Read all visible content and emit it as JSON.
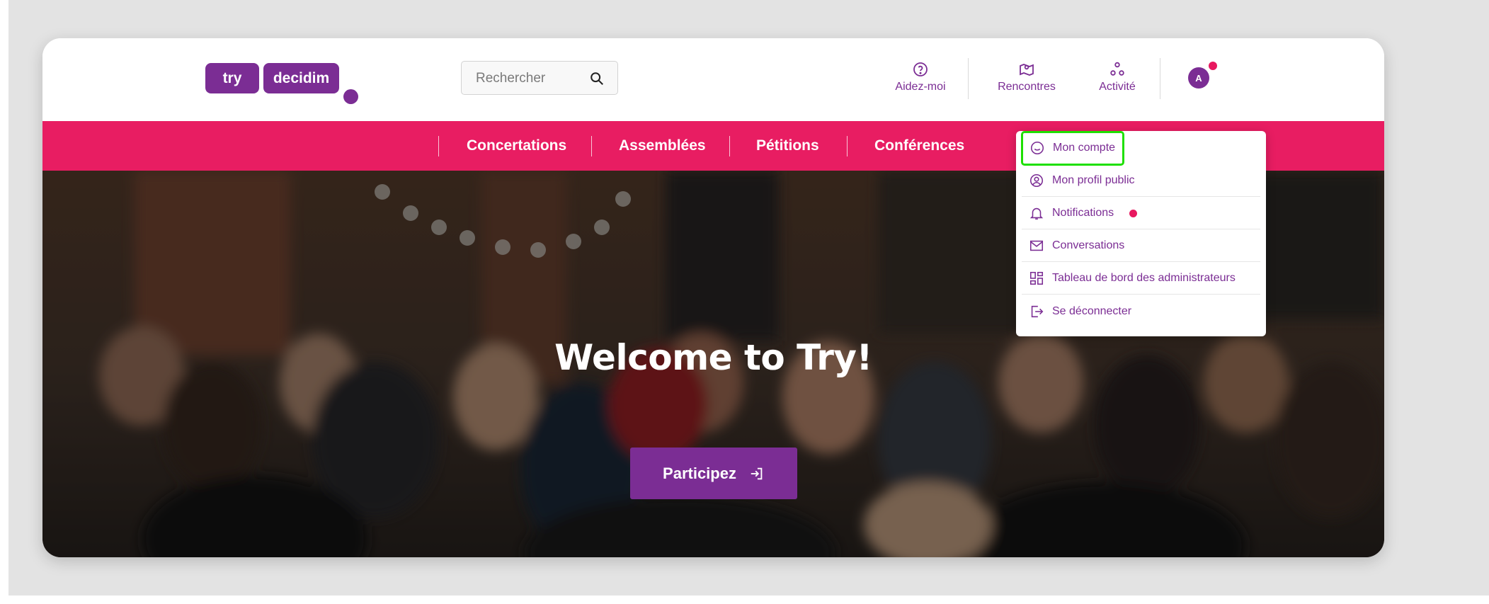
{
  "logo": {
    "part1": "try",
    "part2": "decidim"
  },
  "search": {
    "placeholder": "Rechercher"
  },
  "header_nav": {
    "help": "Aidez-moi",
    "meetings": "Rencontres",
    "activity": "Activité"
  },
  "user": {
    "avatar_initial": "A"
  },
  "main_menu": [
    "Concertations",
    "Assemblées",
    "Pétitions",
    "Conférences"
  ],
  "hero": {
    "title": "Welcome to Try!",
    "cta": "Participez"
  },
  "user_menu": [
    {
      "label": "Mon compte",
      "icon": "smile-icon",
      "selected": true
    },
    {
      "label": "Mon profil public",
      "icon": "user-circle-icon"
    },
    {
      "label": "Notifications",
      "icon": "bell-icon",
      "unread": true
    },
    {
      "label": "Conversations",
      "icon": "mail-icon"
    },
    {
      "label": "Tableau de bord des administrateurs",
      "icon": "dashboard-icon"
    },
    {
      "label": "Se déconnecter",
      "icon": "logout-icon"
    }
  ],
  "colors": {
    "brand_purple": "#7b2d94",
    "menu_pink": "#e81d62",
    "notification_dot": "#e8185f",
    "selection_highlight": "#1ee000"
  }
}
